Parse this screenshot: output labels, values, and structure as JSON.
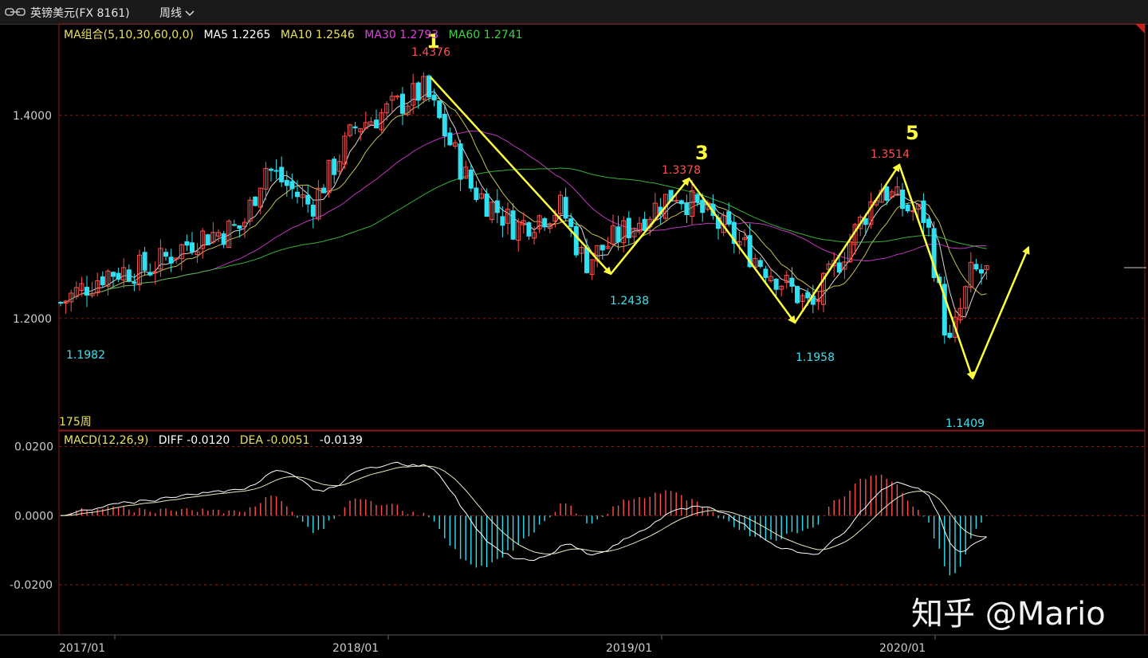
{
  "header": {
    "title": "英镑美元(FX 8161)",
    "period_label": "周线",
    "chevron_icon": "chevron-down-icon",
    "chain_icon": "link-icon"
  },
  "ma_legend": {
    "group_label": "MA组合(5,10,30,60,0,0)",
    "ma5": "MA5 1.2265",
    "ma10": "MA10 1.2546",
    "ma30": "MA30 1.2793",
    "ma60": "MA60 1.2741",
    "colors": {
      "group": "#e8e060",
      "ma5": "#ffffff",
      "ma10": "#e8e060",
      "ma30": "#e040e0",
      "ma60": "#40d040"
    }
  },
  "macd_legend": {
    "label": "MACD(12,26,9)",
    "diff": "DIFF -0.0120",
    "dea": "DEA -0.0051",
    "macd": "-0.0139"
  },
  "weeks_label": "175周",
  "watermark": "知乎 @Mario",
  "price_axis": [
    "1.4000",
    "1.2000"
  ],
  "macd_axis": [
    "0.0200",
    "0.0000",
    "-0.0200"
  ],
  "date_axis": [
    "2017/01",
    "2018/01",
    "2019/01",
    "2020/01"
  ],
  "annotations": {
    "wave_numbers": [
      "1",
      "3",
      "5"
    ],
    "highs": [
      "1.4376",
      "1.3378",
      "1.3514"
    ],
    "lows": [
      "1.1982",
      "1.2438",
      "1.1958",
      "1.1409"
    ]
  },
  "chart_data": {
    "type": "candlestick",
    "price_range": [
      1.09,
      1.49
    ],
    "macd_range": [
      -0.0345,
      0.0245
    ],
    "time_range": [
      "2016/11",
      "2020/12"
    ],
    "marked_points": [
      {
        "label": "1.1982",
        "date": "2016/10",
        "price": 1.1982,
        "kind": "low"
      },
      {
        "label": "1.4376",
        "date": "2018/04",
        "price": 1.4376,
        "kind": "high"
      },
      {
        "label": "1.2438",
        "date": "2018/11",
        "price": 1.2438,
        "kind": "low"
      },
      {
        "label": "1.3378",
        "date": "2019/03",
        "price": 1.3378,
        "kind": "high"
      },
      {
        "label": "1.1958",
        "date": "2019/09",
        "price": 1.1958,
        "kind": "low"
      },
      {
        "label": "1.3514",
        "date": "2019/12",
        "price": 1.3514,
        "kind": "high"
      },
      {
        "label": "1.1409",
        "date": "2020/03",
        "price": 1.1409,
        "kind": "low"
      }
    ],
    "wave_path_prices": [
      1.4376,
      1.2438,
      1.3378,
      1.1958,
      1.3514,
      1.1409,
      1.27
    ],
    "colors": {
      "up": "#ff5050",
      "down": "#30e0f0",
      "arrow": "#ffff40",
      "grid": "#8b1a1a"
    }
  }
}
